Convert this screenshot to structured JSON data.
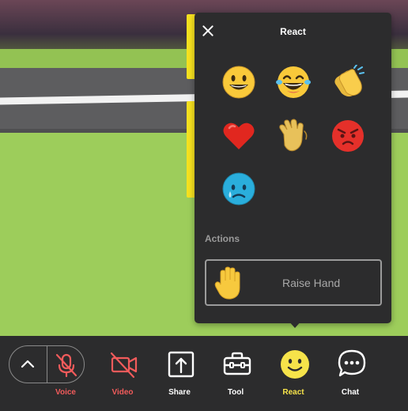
{
  "react_panel": {
    "title": "React",
    "close_icon": "close-icon",
    "emojis": [
      {
        "name": "grinning-face"
      },
      {
        "name": "laughing-face"
      },
      {
        "name": "clapping-hands"
      },
      {
        "name": "red-heart"
      },
      {
        "name": "waving-hand"
      },
      {
        "name": "angry-face"
      },
      {
        "name": "crying-face"
      }
    ],
    "actions_label": "Actions",
    "raise_hand_label": "Raise Hand"
  },
  "toolbar": {
    "voice_label": "Voice",
    "video_label": "Video",
    "share_label": "Share",
    "tool_label": "Tool",
    "react_label": "React",
    "chat_label": "Chat"
  },
  "colors": {
    "panel_bg": "#2c2c2d",
    "muted_red": "#f25b5b",
    "active_yellow": "#f6e34a",
    "grass": "#9dcd5b"
  }
}
